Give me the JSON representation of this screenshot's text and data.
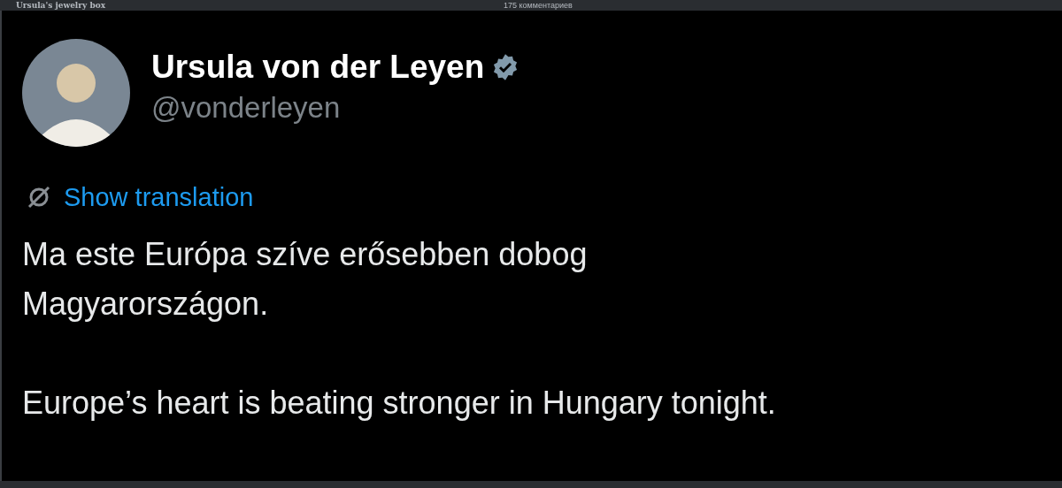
{
  "top_bar": {
    "title": "Ursula's jewelry box",
    "comments": "175 комментариев"
  },
  "tweet": {
    "author": {
      "name": "Ursula von der Leyen",
      "verified": true,
      "handle": "@vonderleyen"
    },
    "translate_link": "Show translation",
    "paragraphs": [
      "Ma este Európa szíve erősebben dobog Magyarországon.",
      "Europe’s heart is beating stronger in Hungary tonight."
    ]
  }
}
